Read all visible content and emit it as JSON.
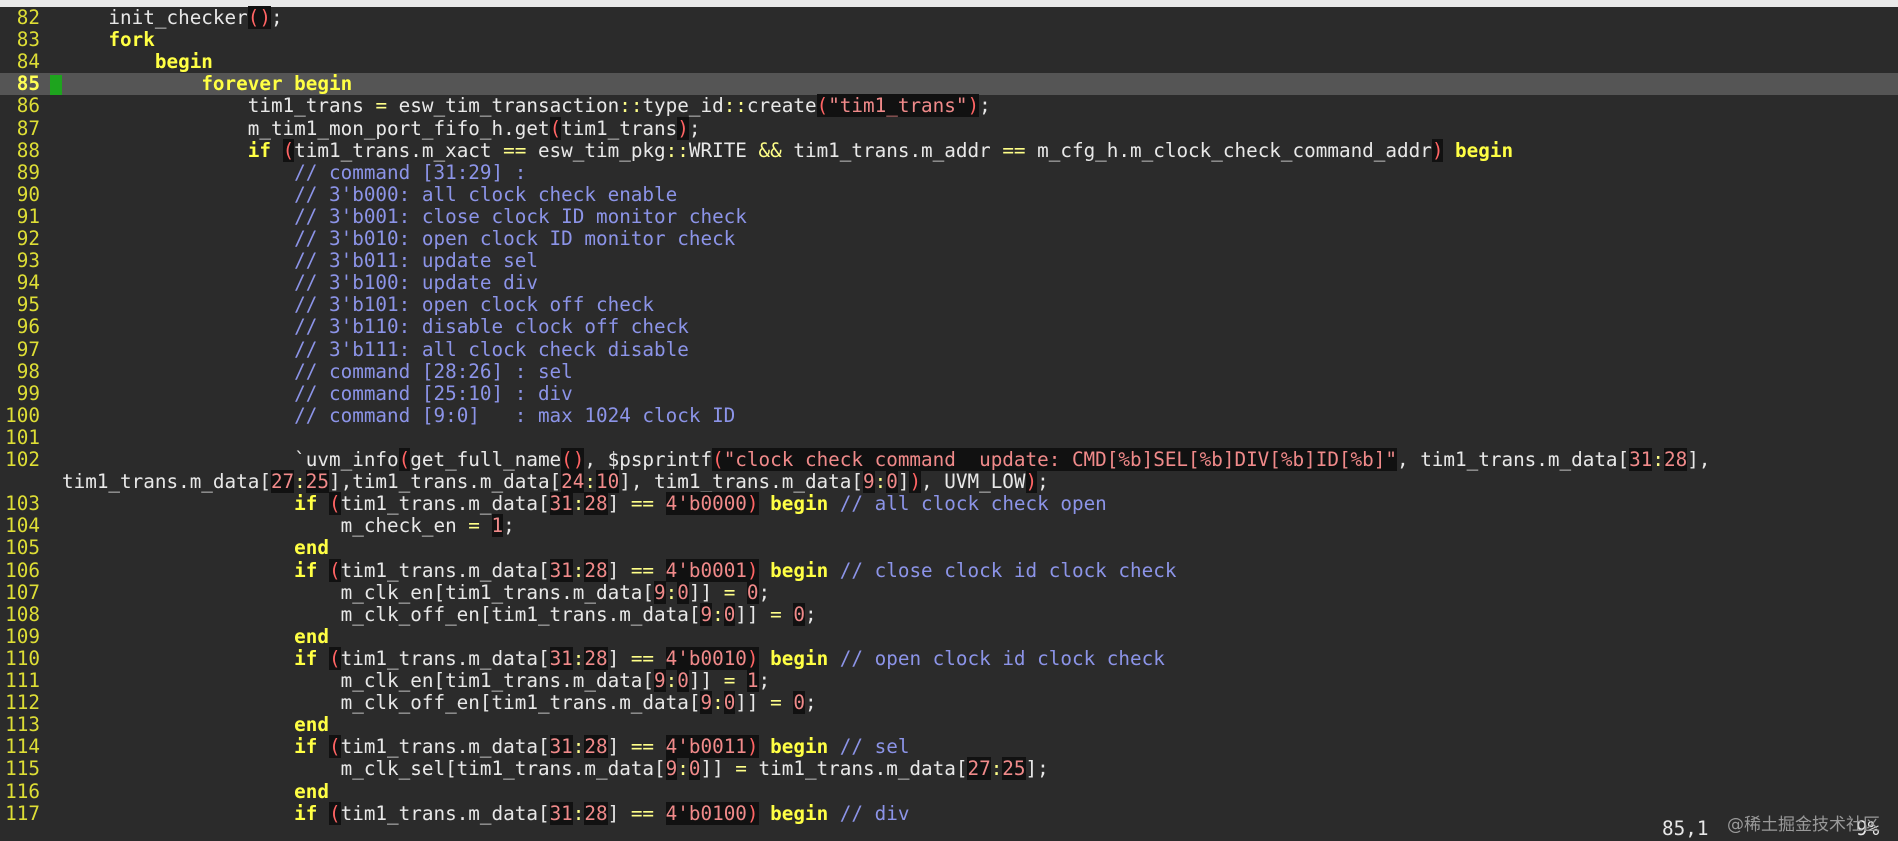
{
  "editor": {
    "cursor_line": 85,
    "lines": [
      {
        "n": "82",
        "segs": [
          [
            "pl",
            "    init_checker"
          ],
          [
            "pn",
            "("
          ],
          [
            "pn",
            ")"
          ],
          [
            "pl",
            ";"
          ]
        ]
      },
      {
        "n": "83",
        "segs": [
          [
            "pl",
            "    "
          ],
          [
            "kw",
            "fork"
          ]
        ]
      },
      {
        "n": "84",
        "segs": [
          [
            "pl",
            "        "
          ],
          [
            "kw",
            "begin"
          ]
        ]
      },
      {
        "n": "85",
        "segs": [
          [
            "pl",
            "            "
          ],
          [
            "kw",
            "forever begin"
          ]
        ]
      },
      {
        "n": "86",
        "segs": [
          [
            "pl",
            "                tim1_trans "
          ],
          [
            "op",
            "="
          ],
          [
            "pl",
            " esw_tim_transaction"
          ],
          [
            "op",
            "::"
          ],
          [
            "pl",
            "type_id"
          ],
          [
            "op",
            "::"
          ],
          [
            "pl",
            "create"
          ],
          [
            "pn",
            "("
          ],
          [
            "st",
            "\"tim1_trans\""
          ],
          [
            "pn",
            ")"
          ],
          [
            "pl",
            ";"
          ]
        ]
      },
      {
        "n": "87",
        "segs": [
          [
            "pl",
            "                m_tim1_mon_port_fifo_h.get"
          ],
          [
            "pn",
            "("
          ],
          [
            "pl",
            "tim1_trans"
          ],
          [
            "pn",
            ")"
          ],
          [
            "pl",
            ";"
          ]
        ]
      },
      {
        "n": "88",
        "segs": [
          [
            "pl",
            "                "
          ],
          [
            "kw",
            "if"
          ],
          [
            "pl",
            " "
          ],
          [
            "pn",
            "("
          ],
          [
            "pl",
            "tim1_trans.m_xact "
          ],
          [
            "op",
            "=="
          ],
          [
            "pl",
            " esw_tim_pkg"
          ],
          [
            "op",
            "::"
          ],
          [
            "pl",
            "WRITE "
          ],
          [
            "op",
            "&&"
          ],
          [
            "pl",
            " tim1_trans.m_addr "
          ],
          [
            "op",
            "=="
          ],
          [
            "pl",
            " m_cfg_h.m_clock_check_command_addr"
          ],
          [
            "pn",
            ")"
          ],
          [
            "pl",
            " "
          ],
          [
            "kw",
            "begin"
          ]
        ]
      },
      {
        "n": "89",
        "segs": [
          [
            "pl",
            "                    "
          ],
          [
            "cm",
            "// command [31:29] :"
          ]
        ]
      },
      {
        "n": "90",
        "segs": [
          [
            "pl",
            "                    "
          ],
          [
            "cm",
            "// 3'b000: all clock check enable"
          ]
        ]
      },
      {
        "n": "91",
        "segs": [
          [
            "pl",
            "                    "
          ],
          [
            "cm",
            "// 3'b001: close clock ID monitor check"
          ]
        ]
      },
      {
        "n": "92",
        "segs": [
          [
            "pl",
            "                    "
          ],
          [
            "cm",
            "// 3'b010: open clock ID monitor check"
          ]
        ]
      },
      {
        "n": "93",
        "segs": [
          [
            "pl",
            "                    "
          ],
          [
            "cm",
            "// 3'b011: update sel"
          ]
        ]
      },
      {
        "n": "94",
        "segs": [
          [
            "pl",
            "                    "
          ],
          [
            "cm",
            "// 3'b100: update div"
          ]
        ]
      },
      {
        "n": "95",
        "segs": [
          [
            "pl",
            "                    "
          ],
          [
            "cm",
            "// 3'b101: open clock off check"
          ]
        ]
      },
      {
        "n": "96",
        "segs": [
          [
            "pl",
            "                    "
          ],
          [
            "cm",
            "// 3'b110: disable clock off check"
          ]
        ]
      },
      {
        "n": "97",
        "segs": [
          [
            "pl",
            "                    "
          ],
          [
            "cm",
            "// 3'b111: all clock check disable"
          ]
        ]
      },
      {
        "n": "98",
        "segs": [
          [
            "pl",
            "                    "
          ],
          [
            "cm",
            "// command [28:26] : sel"
          ]
        ]
      },
      {
        "n": "99",
        "segs": [
          [
            "pl",
            "                    "
          ],
          [
            "cm",
            "// command [25:10] : div"
          ]
        ]
      },
      {
        "n": "100",
        "segs": [
          [
            "pl",
            "                    "
          ],
          [
            "cm",
            "// command [9:0]   : max 1024 clock ID"
          ]
        ]
      },
      {
        "n": "101",
        "segs": []
      },
      {
        "n": "102",
        "segs": [
          [
            "pl",
            "                    `uvm_info"
          ],
          [
            "pn",
            "("
          ],
          [
            "pl",
            "get_full_name"
          ],
          [
            "pn",
            "("
          ],
          [
            "pn",
            ")"
          ],
          [
            "pl",
            ", $psprintf"
          ],
          [
            "pn",
            "("
          ],
          [
            "st",
            "\"clock check command  update: CMD[%b]SEL[%b]DIV[%b]ID[%b]\""
          ],
          [
            "pl",
            ", tim1_trans.m_data["
          ],
          [
            "num",
            "31"
          ],
          [
            "op",
            ":"
          ],
          [
            "num",
            "28"
          ],
          [
            "pl",
            "],"
          ]
        ]
      },
      {
        "n": "",
        "segs": [
          [
            "pl",
            "tim1_trans.m_data["
          ],
          [
            "num",
            "27"
          ],
          [
            "op",
            ":"
          ],
          [
            "num",
            "25"
          ],
          [
            "pl",
            "],tim1_trans.m_data["
          ],
          [
            "num",
            "24"
          ],
          [
            "op",
            ":"
          ],
          [
            "num",
            "10"
          ],
          [
            "pl",
            "], tim1_trans.m_data["
          ],
          [
            "num",
            "9"
          ],
          [
            "op",
            ":"
          ],
          [
            "num",
            "0"
          ],
          [
            "pl",
            "]"
          ],
          [
            "pn",
            ")"
          ],
          [
            "pl",
            ", UVM_LOW"
          ],
          [
            "pn",
            ")"
          ],
          [
            "pl",
            ";"
          ]
        ],
        "wrap": true
      },
      {
        "n": "103",
        "segs": [
          [
            "pl",
            "                    "
          ],
          [
            "kw",
            "if"
          ],
          [
            "pl",
            " "
          ],
          [
            "pn",
            "("
          ],
          [
            "pl",
            "tim1_trans.m_data["
          ],
          [
            "num",
            "31"
          ],
          [
            "op",
            ":"
          ],
          [
            "num",
            "28"
          ],
          [
            "pl",
            "] "
          ],
          [
            "op",
            "=="
          ],
          [
            "pl",
            " "
          ],
          [
            "num",
            "4'b0000"
          ],
          [
            "pn",
            ")"
          ],
          [
            "pl",
            " "
          ],
          [
            "kw",
            "begin"
          ],
          [
            "pl",
            " "
          ],
          [
            "cm",
            "// all clock check open"
          ]
        ]
      },
      {
        "n": "104",
        "segs": [
          [
            "pl",
            "                        m_check_en "
          ],
          [
            "op",
            "="
          ],
          [
            "pl",
            " "
          ],
          [
            "num",
            "1"
          ],
          [
            "pl",
            ";"
          ]
        ]
      },
      {
        "n": "105",
        "segs": [
          [
            "pl",
            "                    "
          ],
          [
            "kw",
            "end"
          ]
        ]
      },
      {
        "n": "106",
        "segs": [
          [
            "pl",
            "                    "
          ],
          [
            "kw",
            "if"
          ],
          [
            "pl",
            " "
          ],
          [
            "pn",
            "("
          ],
          [
            "pl",
            "tim1_trans.m_data["
          ],
          [
            "num",
            "31"
          ],
          [
            "op",
            ":"
          ],
          [
            "num",
            "28"
          ],
          [
            "pl",
            "] "
          ],
          [
            "op",
            "=="
          ],
          [
            "pl",
            " "
          ],
          [
            "num",
            "4'b0001"
          ],
          [
            "pn",
            ")"
          ],
          [
            "pl",
            " "
          ],
          [
            "kw",
            "begin"
          ],
          [
            "pl",
            " "
          ],
          [
            "cm",
            "// close clock id clock check"
          ]
        ]
      },
      {
        "n": "107",
        "segs": [
          [
            "pl",
            "                        m_clk_en[tim1_trans.m_data["
          ],
          [
            "num",
            "9"
          ],
          [
            "op",
            ":"
          ],
          [
            "num",
            "0"
          ],
          [
            "pl",
            "]] "
          ],
          [
            "op",
            "="
          ],
          [
            "pl",
            " "
          ],
          [
            "num",
            "0"
          ],
          [
            "pl",
            ";"
          ]
        ]
      },
      {
        "n": "108",
        "segs": [
          [
            "pl",
            "                        m_clk_off_en[tim1_trans.m_data["
          ],
          [
            "num",
            "9"
          ],
          [
            "op",
            ":"
          ],
          [
            "num",
            "0"
          ],
          [
            "pl",
            "]] "
          ],
          [
            "op",
            "="
          ],
          [
            "pl",
            " "
          ],
          [
            "num",
            "0"
          ],
          [
            "pl",
            ";"
          ]
        ]
      },
      {
        "n": "109",
        "segs": [
          [
            "pl",
            "                    "
          ],
          [
            "kw",
            "end"
          ]
        ]
      },
      {
        "n": "110",
        "segs": [
          [
            "pl",
            "                    "
          ],
          [
            "kw",
            "if"
          ],
          [
            "pl",
            " "
          ],
          [
            "pn",
            "("
          ],
          [
            "pl",
            "tim1_trans.m_data["
          ],
          [
            "num",
            "31"
          ],
          [
            "op",
            ":"
          ],
          [
            "num",
            "28"
          ],
          [
            "pl",
            "] "
          ],
          [
            "op",
            "=="
          ],
          [
            "pl",
            " "
          ],
          [
            "num",
            "4'b0010"
          ],
          [
            "pn",
            ")"
          ],
          [
            "pl",
            " "
          ],
          [
            "kw",
            "begin"
          ],
          [
            "pl",
            " "
          ],
          [
            "cm",
            "// open clock id clock check"
          ]
        ]
      },
      {
        "n": "111",
        "segs": [
          [
            "pl",
            "                        m_clk_en[tim1_trans.m_data["
          ],
          [
            "num",
            "9"
          ],
          [
            "op",
            ":"
          ],
          [
            "num",
            "0"
          ],
          [
            "pl",
            "]] "
          ],
          [
            "op",
            "="
          ],
          [
            "pl",
            " "
          ],
          [
            "num",
            "1"
          ],
          [
            "pl",
            ";"
          ]
        ]
      },
      {
        "n": "112",
        "segs": [
          [
            "pl",
            "                        m_clk_off_en[tim1_trans.m_data["
          ],
          [
            "num",
            "9"
          ],
          [
            "op",
            ":"
          ],
          [
            "num",
            "0"
          ],
          [
            "pl",
            "]] "
          ],
          [
            "op",
            "="
          ],
          [
            "pl",
            " "
          ],
          [
            "num",
            "0"
          ],
          [
            "pl",
            ";"
          ]
        ]
      },
      {
        "n": "113",
        "segs": [
          [
            "pl",
            "                    "
          ],
          [
            "kw",
            "end"
          ]
        ]
      },
      {
        "n": "114",
        "segs": [
          [
            "pl",
            "                    "
          ],
          [
            "kw",
            "if"
          ],
          [
            "pl",
            " "
          ],
          [
            "pn",
            "("
          ],
          [
            "pl",
            "tim1_trans.m_data["
          ],
          [
            "num",
            "31"
          ],
          [
            "op",
            ":"
          ],
          [
            "num",
            "28"
          ],
          [
            "pl",
            "] "
          ],
          [
            "op",
            "=="
          ],
          [
            "pl",
            " "
          ],
          [
            "num",
            "4'b0011"
          ],
          [
            "pn",
            ")"
          ],
          [
            "pl",
            " "
          ],
          [
            "kw",
            "begin"
          ],
          [
            "pl",
            " "
          ],
          [
            "cm",
            "// sel"
          ]
        ]
      },
      {
        "n": "115",
        "segs": [
          [
            "pl",
            "                        m_clk_sel[tim1_trans.m_data["
          ],
          [
            "num",
            "9"
          ],
          [
            "op",
            ":"
          ],
          [
            "num",
            "0"
          ],
          [
            "pl",
            "]] "
          ],
          [
            "op",
            "="
          ],
          [
            "pl",
            " tim1_trans.m_data["
          ],
          [
            "num",
            "27"
          ],
          [
            "op",
            ":"
          ],
          [
            "num",
            "25"
          ],
          [
            "pl",
            "];"
          ]
        ]
      },
      {
        "n": "116",
        "segs": [
          [
            "pl",
            "                    "
          ],
          [
            "kw",
            "end"
          ]
        ]
      },
      {
        "n": "117",
        "segs": [
          [
            "pl",
            "                    "
          ],
          [
            "kw",
            "if"
          ],
          [
            "pl",
            " "
          ],
          [
            "pn",
            "("
          ],
          [
            "pl",
            "tim1_trans.m_data["
          ],
          [
            "num",
            "31"
          ],
          [
            "op",
            ":"
          ],
          [
            "num",
            "28"
          ],
          [
            "pl",
            "] "
          ],
          [
            "op",
            "=="
          ],
          [
            "pl",
            " "
          ],
          [
            "num",
            "4'b0100"
          ],
          [
            "pn",
            ")"
          ],
          [
            "pl",
            " "
          ],
          [
            "kw",
            "begin"
          ],
          [
            "pl",
            " "
          ],
          [
            "cm",
            "// div"
          ]
        ]
      }
    ]
  },
  "status": {
    "position": "85,1",
    "percent": "9%"
  },
  "watermark": "@稀土掘金技术社区"
}
